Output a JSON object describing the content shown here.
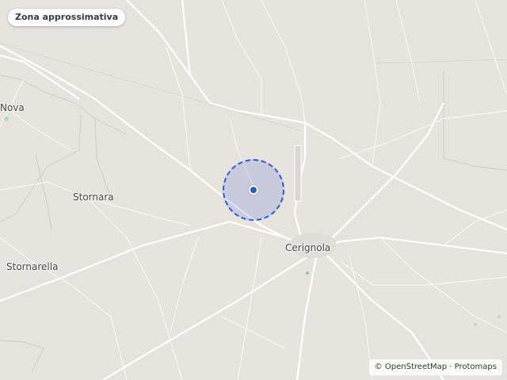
{
  "map": {
    "badge_label": "Zona approssimativa",
    "places": {
      "nova": "Nova",
      "stornara": "Stornara",
      "stornarella": "Stornarella",
      "cerignola": "Cerignola"
    },
    "attribution": {
      "symbol": "©",
      "text": "OpenStreetMap · Protomaps"
    },
    "colors": {
      "land": "#e6e3df",
      "road": "#ffffff",
      "accuracy_circle": "#2f5bd4",
      "location_dot": "#2a58d0"
    },
    "icons": [
      "location-dot-icon",
      "accuracy-circle"
    ]
  }
}
